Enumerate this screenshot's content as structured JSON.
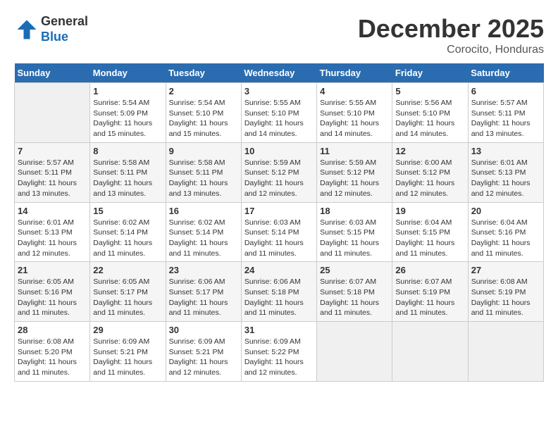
{
  "header": {
    "logo_line1": "General",
    "logo_line2": "Blue",
    "month_title": "December 2025",
    "location": "Corocito, Honduras"
  },
  "weekdays": [
    "Sunday",
    "Monday",
    "Tuesday",
    "Wednesday",
    "Thursday",
    "Friday",
    "Saturday"
  ],
  "weeks": [
    [
      {
        "day": "",
        "info": ""
      },
      {
        "day": "1",
        "info": "Sunrise: 5:54 AM\nSunset: 5:09 PM\nDaylight: 11 hours\nand 15 minutes."
      },
      {
        "day": "2",
        "info": "Sunrise: 5:54 AM\nSunset: 5:10 PM\nDaylight: 11 hours\nand 15 minutes."
      },
      {
        "day": "3",
        "info": "Sunrise: 5:55 AM\nSunset: 5:10 PM\nDaylight: 11 hours\nand 14 minutes."
      },
      {
        "day": "4",
        "info": "Sunrise: 5:55 AM\nSunset: 5:10 PM\nDaylight: 11 hours\nand 14 minutes."
      },
      {
        "day": "5",
        "info": "Sunrise: 5:56 AM\nSunset: 5:10 PM\nDaylight: 11 hours\nand 14 minutes."
      },
      {
        "day": "6",
        "info": "Sunrise: 5:57 AM\nSunset: 5:11 PM\nDaylight: 11 hours\nand 13 minutes."
      }
    ],
    [
      {
        "day": "7",
        "info": "Sunrise: 5:57 AM\nSunset: 5:11 PM\nDaylight: 11 hours\nand 13 minutes."
      },
      {
        "day": "8",
        "info": "Sunrise: 5:58 AM\nSunset: 5:11 PM\nDaylight: 11 hours\nand 13 minutes."
      },
      {
        "day": "9",
        "info": "Sunrise: 5:58 AM\nSunset: 5:11 PM\nDaylight: 11 hours\nand 13 minutes."
      },
      {
        "day": "10",
        "info": "Sunrise: 5:59 AM\nSunset: 5:12 PM\nDaylight: 11 hours\nand 12 minutes."
      },
      {
        "day": "11",
        "info": "Sunrise: 5:59 AM\nSunset: 5:12 PM\nDaylight: 11 hours\nand 12 minutes."
      },
      {
        "day": "12",
        "info": "Sunrise: 6:00 AM\nSunset: 5:12 PM\nDaylight: 11 hours\nand 12 minutes."
      },
      {
        "day": "13",
        "info": "Sunrise: 6:01 AM\nSunset: 5:13 PM\nDaylight: 11 hours\nand 12 minutes."
      }
    ],
    [
      {
        "day": "14",
        "info": "Sunrise: 6:01 AM\nSunset: 5:13 PM\nDaylight: 11 hours\nand 12 minutes."
      },
      {
        "day": "15",
        "info": "Sunrise: 6:02 AM\nSunset: 5:14 PM\nDaylight: 11 hours\nand 11 minutes."
      },
      {
        "day": "16",
        "info": "Sunrise: 6:02 AM\nSunset: 5:14 PM\nDaylight: 11 hours\nand 11 minutes."
      },
      {
        "day": "17",
        "info": "Sunrise: 6:03 AM\nSunset: 5:14 PM\nDaylight: 11 hours\nand 11 minutes."
      },
      {
        "day": "18",
        "info": "Sunrise: 6:03 AM\nSunset: 5:15 PM\nDaylight: 11 hours\nand 11 minutes."
      },
      {
        "day": "19",
        "info": "Sunrise: 6:04 AM\nSunset: 5:15 PM\nDaylight: 11 hours\nand 11 minutes."
      },
      {
        "day": "20",
        "info": "Sunrise: 6:04 AM\nSunset: 5:16 PM\nDaylight: 11 hours\nand 11 minutes."
      }
    ],
    [
      {
        "day": "21",
        "info": "Sunrise: 6:05 AM\nSunset: 5:16 PM\nDaylight: 11 hours\nand 11 minutes."
      },
      {
        "day": "22",
        "info": "Sunrise: 6:05 AM\nSunset: 5:17 PM\nDaylight: 11 hours\nand 11 minutes."
      },
      {
        "day": "23",
        "info": "Sunrise: 6:06 AM\nSunset: 5:17 PM\nDaylight: 11 hours\nand 11 minutes."
      },
      {
        "day": "24",
        "info": "Sunrise: 6:06 AM\nSunset: 5:18 PM\nDaylight: 11 hours\nand 11 minutes."
      },
      {
        "day": "25",
        "info": "Sunrise: 6:07 AM\nSunset: 5:18 PM\nDaylight: 11 hours\nand 11 minutes."
      },
      {
        "day": "26",
        "info": "Sunrise: 6:07 AM\nSunset: 5:19 PM\nDaylight: 11 hours\nand 11 minutes."
      },
      {
        "day": "27",
        "info": "Sunrise: 6:08 AM\nSunset: 5:19 PM\nDaylight: 11 hours\nand 11 minutes."
      }
    ],
    [
      {
        "day": "28",
        "info": "Sunrise: 6:08 AM\nSunset: 5:20 PM\nDaylight: 11 hours\nand 11 minutes."
      },
      {
        "day": "29",
        "info": "Sunrise: 6:09 AM\nSunset: 5:21 PM\nDaylight: 11 hours\nand 11 minutes."
      },
      {
        "day": "30",
        "info": "Sunrise: 6:09 AM\nSunset: 5:21 PM\nDaylight: 11 hours\nand 12 minutes."
      },
      {
        "day": "31",
        "info": "Sunrise: 6:09 AM\nSunset: 5:22 PM\nDaylight: 11 hours\nand 12 minutes."
      },
      {
        "day": "",
        "info": ""
      },
      {
        "day": "",
        "info": ""
      },
      {
        "day": "",
        "info": ""
      }
    ]
  ]
}
